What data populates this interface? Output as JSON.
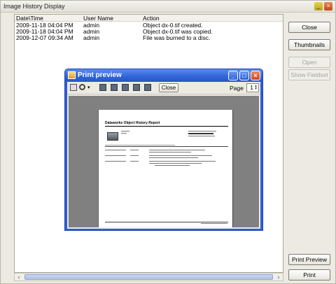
{
  "window": {
    "title": "Image History Display"
  },
  "table": {
    "columns": [
      "Date\\Time",
      "User Name",
      "Action"
    ],
    "rows": [
      [
        "2009-11-18 04:04 PM",
        "admin",
        "Object dx-0.tif created."
      ],
      [
        "2009-11-18 04:04 PM",
        "admin",
        "Object dx-0.tif was copied."
      ],
      [
        "2009-12-07 09:34 AM",
        "admin",
        "File was burned to a disc."
      ]
    ]
  },
  "side_buttons": {
    "close": "Close",
    "thumbnails": "Thumbnails",
    "open": "Open",
    "show_fieldset": "Show Fieldset",
    "print_preview": "Print Preview",
    "print": "Print"
  },
  "print_preview": {
    "title": "Print preview",
    "close_label": "Close",
    "page_label": "Page",
    "page_value": "1",
    "report_title": "Dataworks Object History Report"
  },
  "colors": {
    "titlebar_blue": "#2f5fd6",
    "window_bg": "#eceae2",
    "preview_area": "#808080"
  },
  "icons": [
    "minimize-icon",
    "close-icon",
    "print-icon",
    "zoom-icon",
    "page-layout-icon",
    "scroll-left-icon",
    "scroll-right-icon"
  ]
}
